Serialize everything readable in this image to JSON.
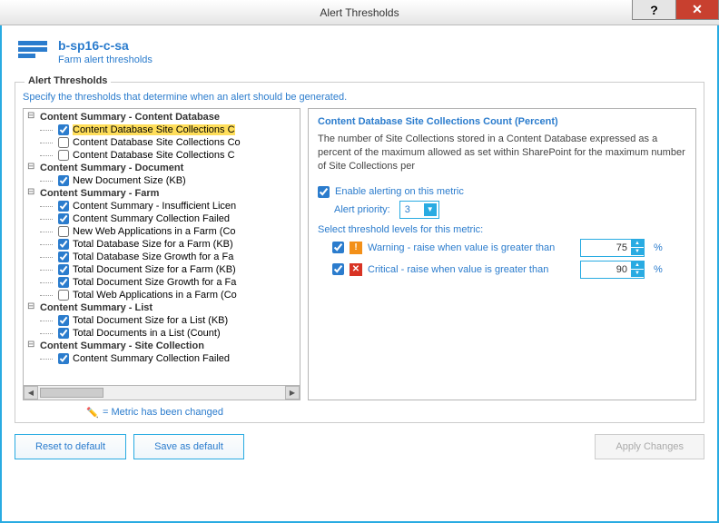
{
  "window": {
    "title": "Alert Thresholds"
  },
  "header": {
    "title": "b-sp16-c-sa",
    "subtitle": "Farm alert thresholds"
  },
  "groupbox": {
    "legend": "Alert Thresholds",
    "note": "Specify the thresholds that determine when an alert should be generated."
  },
  "tree": {
    "groups": [
      {
        "label": "Content Summary - Content Database",
        "items": [
          {
            "checked": true,
            "label": "Content Database Site Collections C",
            "selected": true
          },
          {
            "checked": false,
            "label": "Content Database Site Collections Co"
          },
          {
            "checked": false,
            "label": "Content Database Site Collections C"
          }
        ]
      },
      {
        "label": "Content Summary - Document",
        "items": [
          {
            "checked": true,
            "label": "New Document Size (KB)"
          }
        ]
      },
      {
        "label": "Content Summary - Farm",
        "items": [
          {
            "checked": true,
            "label": "Content Summary - Insufficient Licen"
          },
          {
            "checked": true,
            "label": "Content Summary Collection Failed"
          },
          {
            "checked": false,
            "label": "New Web Applications in a Farm (Co"
          },
          {
            "checked": true,
            "label": "Total Database Size for a Farm (KB)"
          },
          {
            "checked": true,
            "label": "Total Database Size Growth for a Fa"
          },
          {
            "checked": true,
            "label": "Total Document Size for a Farm (KB)"
          },
          {
            "checked": true,
            "label": "Total Document Size Growth for a Fa"
          },
          {
            "checked": false,
            "label": "Total Web Applications in a Farm (Co"
          }
        ]
      },
      {
        "label": "Content Summary - List",
        "items": [
          {
            "checked": true,
            "label": "Total Document Size for a List (KB)"
          },
          {
            "checked": true,
            "label": "Total Documents in a List (Count)"
          }
        ]
      },
      {
        "label": "Content Summary - Site Collection",
        "items": [
          {
            "checked": true,
            "label": "Content Summary Collection Failed"
          }
        ]
      }
    ]
  },
  "detail": {
    "title": "Content Database Site Collections Count (Percent)",
    "desc": "The number of Site Collections stored in a Content Database expressed as a percent of the maximum allowed as set within SharePoint for the maximum number of Site Collections per",
    "enable_label": "Enable alerting on this metric",
    "enable_checked": true,
    "priority_label": "Alert priority:",
    "priority_value": "3",
    "select_levels_label": "Select threshold levels for this metric:",
    "warning": {
      "checked": true,
      "label": "Warning - raise when value is greater than",
      "value": "75",
      "unit": "%"
    },
    "critical": {
      "checked": true,
      "label": "Critical - raise when value is greater than",
      "value": "90",
      "unit": "%"
    }
  },
  "legendnote": "= Metric has been changed",
  "buttons": {
    "reset": "Reset to default",
    "save": "Save as default",
    "apply": "Apply Changes"
  }
}
